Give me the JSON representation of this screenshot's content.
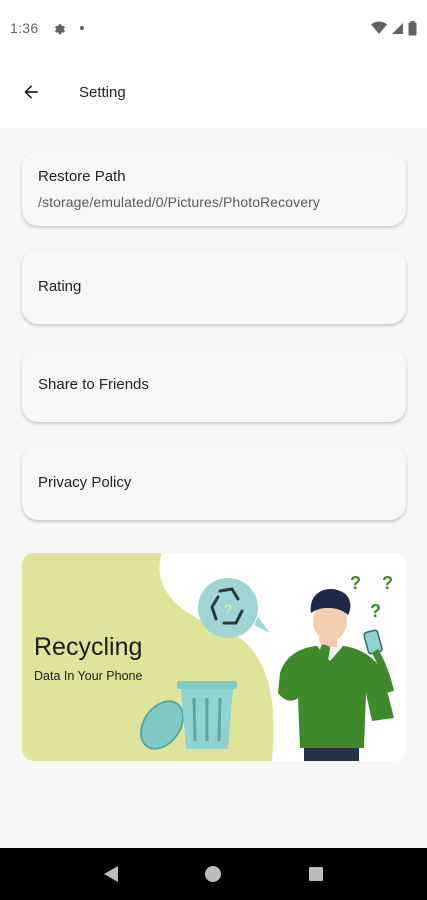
{
  "status_bar": {
    "time": "1:36",
    "icons": [
      "settings-gear-icon",
      "notification-dot-icon",
      "wifi-icon",
      "signal-icon",
      "battery-icon"
    ]
  },
  "toolbar": {
    "back_icon": "arrow-left-icon",
    "title": "Setting"
  },
  "settings": {
    "restore_path": {
      "label": "Restore Path",
      "value": "/storage/emulated/0/Pictures/PhotoRecovery"
    },
    "rating": {
      "label": "Rating"
    },
    "share": {
      "label": "Share to Friends"
    },
    "privacy": {
      "label": "Privacy Policy"
    }
  },
  "banner": {
    "title": "Recycling",
    "subtitle": "Data In Your Phone",
    "colors": {
      "background_shape": "#e0e39a",
      "recycle_bubble": "#9fd6d4",
      "trash_can": "#7fcac7",
      "shirt": "#3e8a2a",
      "question_marks": "#3d8b1f"
    }
  },
  "nav_bar": {
    "back_icon": "triangle-back-icon",
    "home_icon": "circle-home-icon",
    "recents_icon": "square-recents-icon"
  },
  "colors": {
    "background": "#f6f6f6",
    "card": "#f7f7f7",
    "toolbar": "#ffffff"
  }
}
